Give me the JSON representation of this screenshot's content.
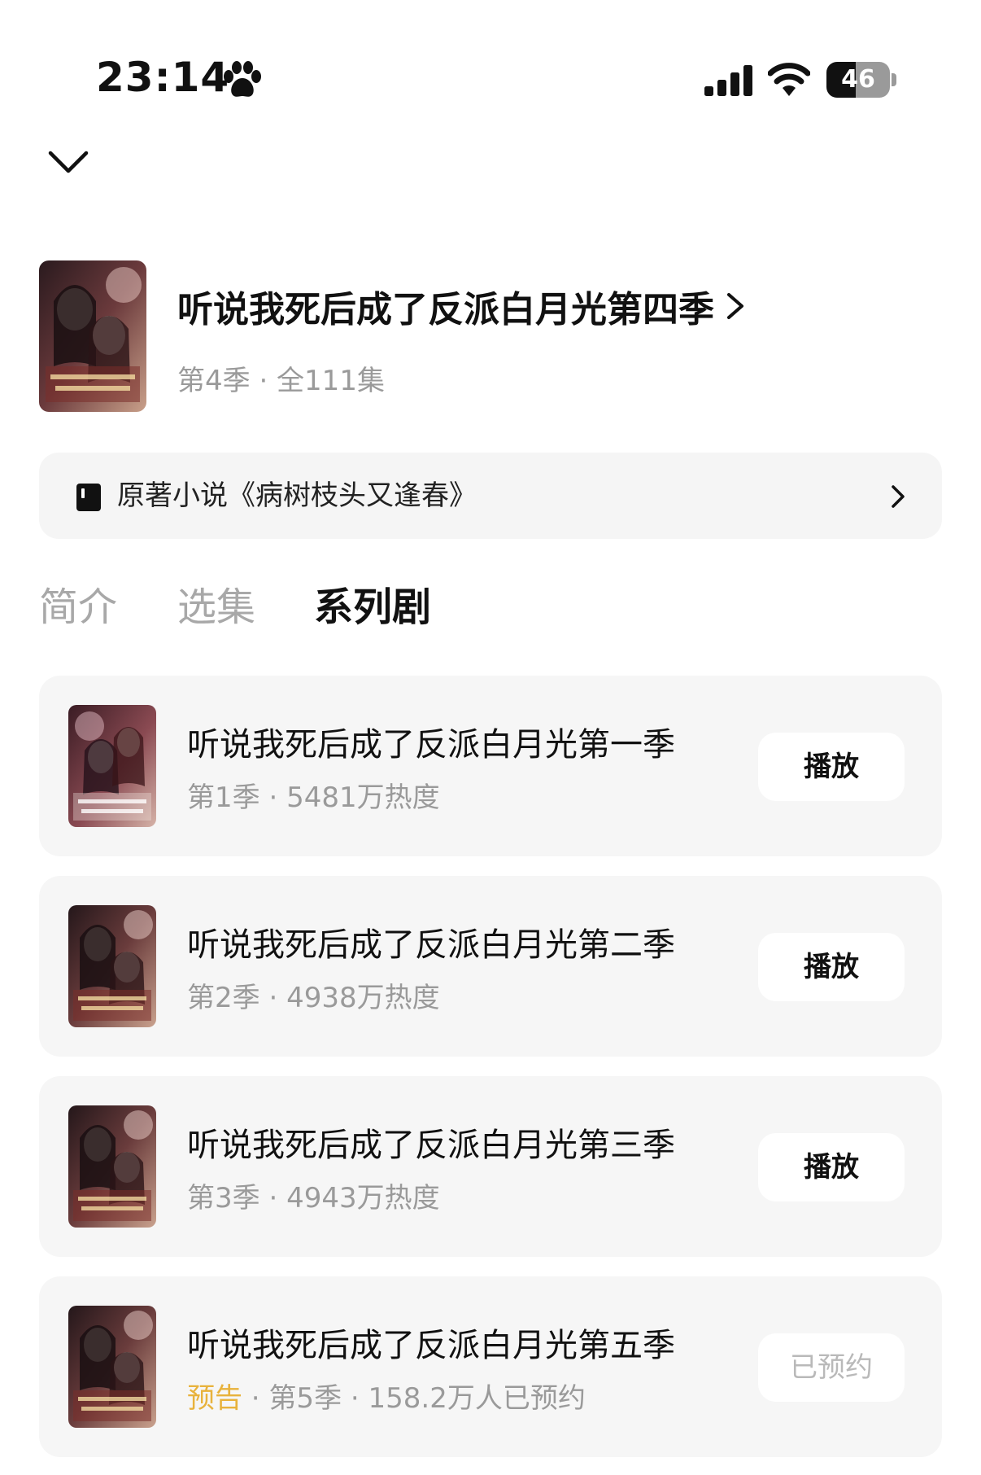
{
  "status_bar": {
    "time": "23:14",
    "battery": "46",
    "battery_level_percent": 46,
    "icons": [
      "paw-icon",
      "signal-icon",
      "wifi-icon",
      "battery-icon"
    ]
  },
  "header": {
    "collapse_icon": "chevron-down-icon",
    "title": "听说我死后成了反派白月光第四季",
    "meta": "第4季 · 全111集"
  },
  "novel": {
    "icon": "book-icon",
    "text": "原著小说《病树枝头又逢春》"
  },
  "tabs": [
    {
      "label": "简介",
      "active": false
    },
    {
      "label": "选集",
      "active": false
    },
    {
      "label": "系列剧",
      "active": true
    }
  ],
  "series": [
    {
      "title": "听说我死后成了反派白月光第一季",
      "season": "第1季",
      "stat": "5481万热度",
      "button": "播放"
    },
    {
      "title": "听说我死后成了反派白月光第二季",
      "season": "第2季",
      "stat": "4938万热度",
      "button": "播放"
    },
    {
      "title": "听说我死后成了反派白月光第三季",
      "season": "第3季",
      "stat": "4943万热度",
      "button": "播放"
    },
    {
      "title": "听说我死后成了反派白月光第五季",
      "tag": "预告",
      "season": "第5季",
      "stat": "158.2万人已预约",
      "button": "已预约"
    }
  ],
  "colors": {
    "accent_trailer": "#e8b23c",
    "muted_text": "#9a9a9a",
    "card_bg": "#f6f6f6"
  }
}
